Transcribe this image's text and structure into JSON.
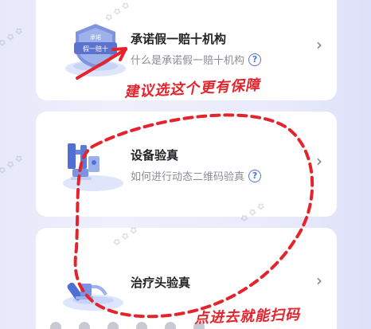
{
  "items": [
    {
      "title": "承诺假一赔十机构",
      "subtitle": "什么是承诺假一赔十机构",
      "badge_text": [
        "承诺",
        "假一赔十"
      ],
      "icon": "badge-icon"
    },
    {
      "title": "设备验真",
      "subtitle": "如何进行动态二维码验真",
      "icon": "device-icon"
    },
    {
      "title": "治疗头验真",
      "subtitle": "",
      "icon": "treatment-head-icon"
    }
  ],
  "help_glyph": "?",
  "chevron_glyph": "›",
  "annotations": {
    "note_1": "建议选这个更有保障",
    "note_2": "点进去就能扫码",
    "color": "#e4232c"
  }
}
